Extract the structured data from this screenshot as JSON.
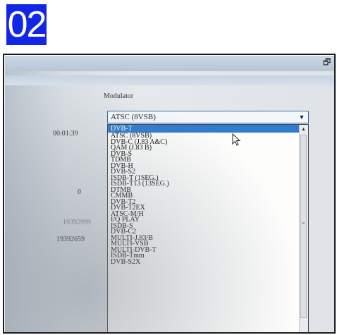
{
  "slide": {
    "number": "02"
  },
  "left_panel": {
    "time": "00:01:39",
    "value_zero": "0",
    "value_1": "19392999",
    "value_2": "19392659"
  },
  "modulator": {
    "label": "Modulator",
    "selected": "ATSC (8VSB)",
    "options": [
      "DVB-T",
      "ATSC (8VSB)",
      "DVB-C (J.83 A&C)",
      "QAM (J.83 B)",
      "DVB-S",
      "TDMB",
      "DVB-H",
      "DVB-S2",
      "ISDB-T (1SEG.)",
      "ISDB-T13 (13SEG.)",
      "DTMB",
      "CMMB",
      "DVB-T2",
      "DVB-T2EX",
      "ATSC-M/H",
      "I/Q PLAY",
      "ISDB-S",
      "DVB-C2",
      "MULTI-J.83/B",
      "MULTI-VSB",
      "MULTI-DVB-T",
      "ISDB-Tmm",
      "DVB-S2X"
    ],
    "highlighted_index": 0
  },
  "icons": {
    "restore": "restore-window-icon",
    "dropdown": "chevron-down-icon",
    "cursor": "mouse-pointer-icon"
  }
}
